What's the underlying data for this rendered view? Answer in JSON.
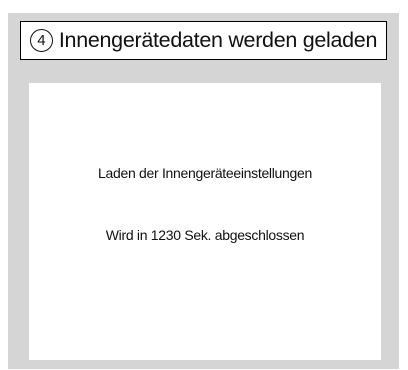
{
  "header": {
    "step_number": "4",
    "title": "Innengerätedaten werden geladen"
  },
  "content": {
    "loading_message": "Laden der Innengeräteeinstellungen",
    "completion_message": "Wird in 1230 Sek. abgeschlossen"
  },
  "colors": {
    "screen_background": "#d5d5d5",
    "panel_background": "#ffffff",
    "text": "#111111"
  }
}
